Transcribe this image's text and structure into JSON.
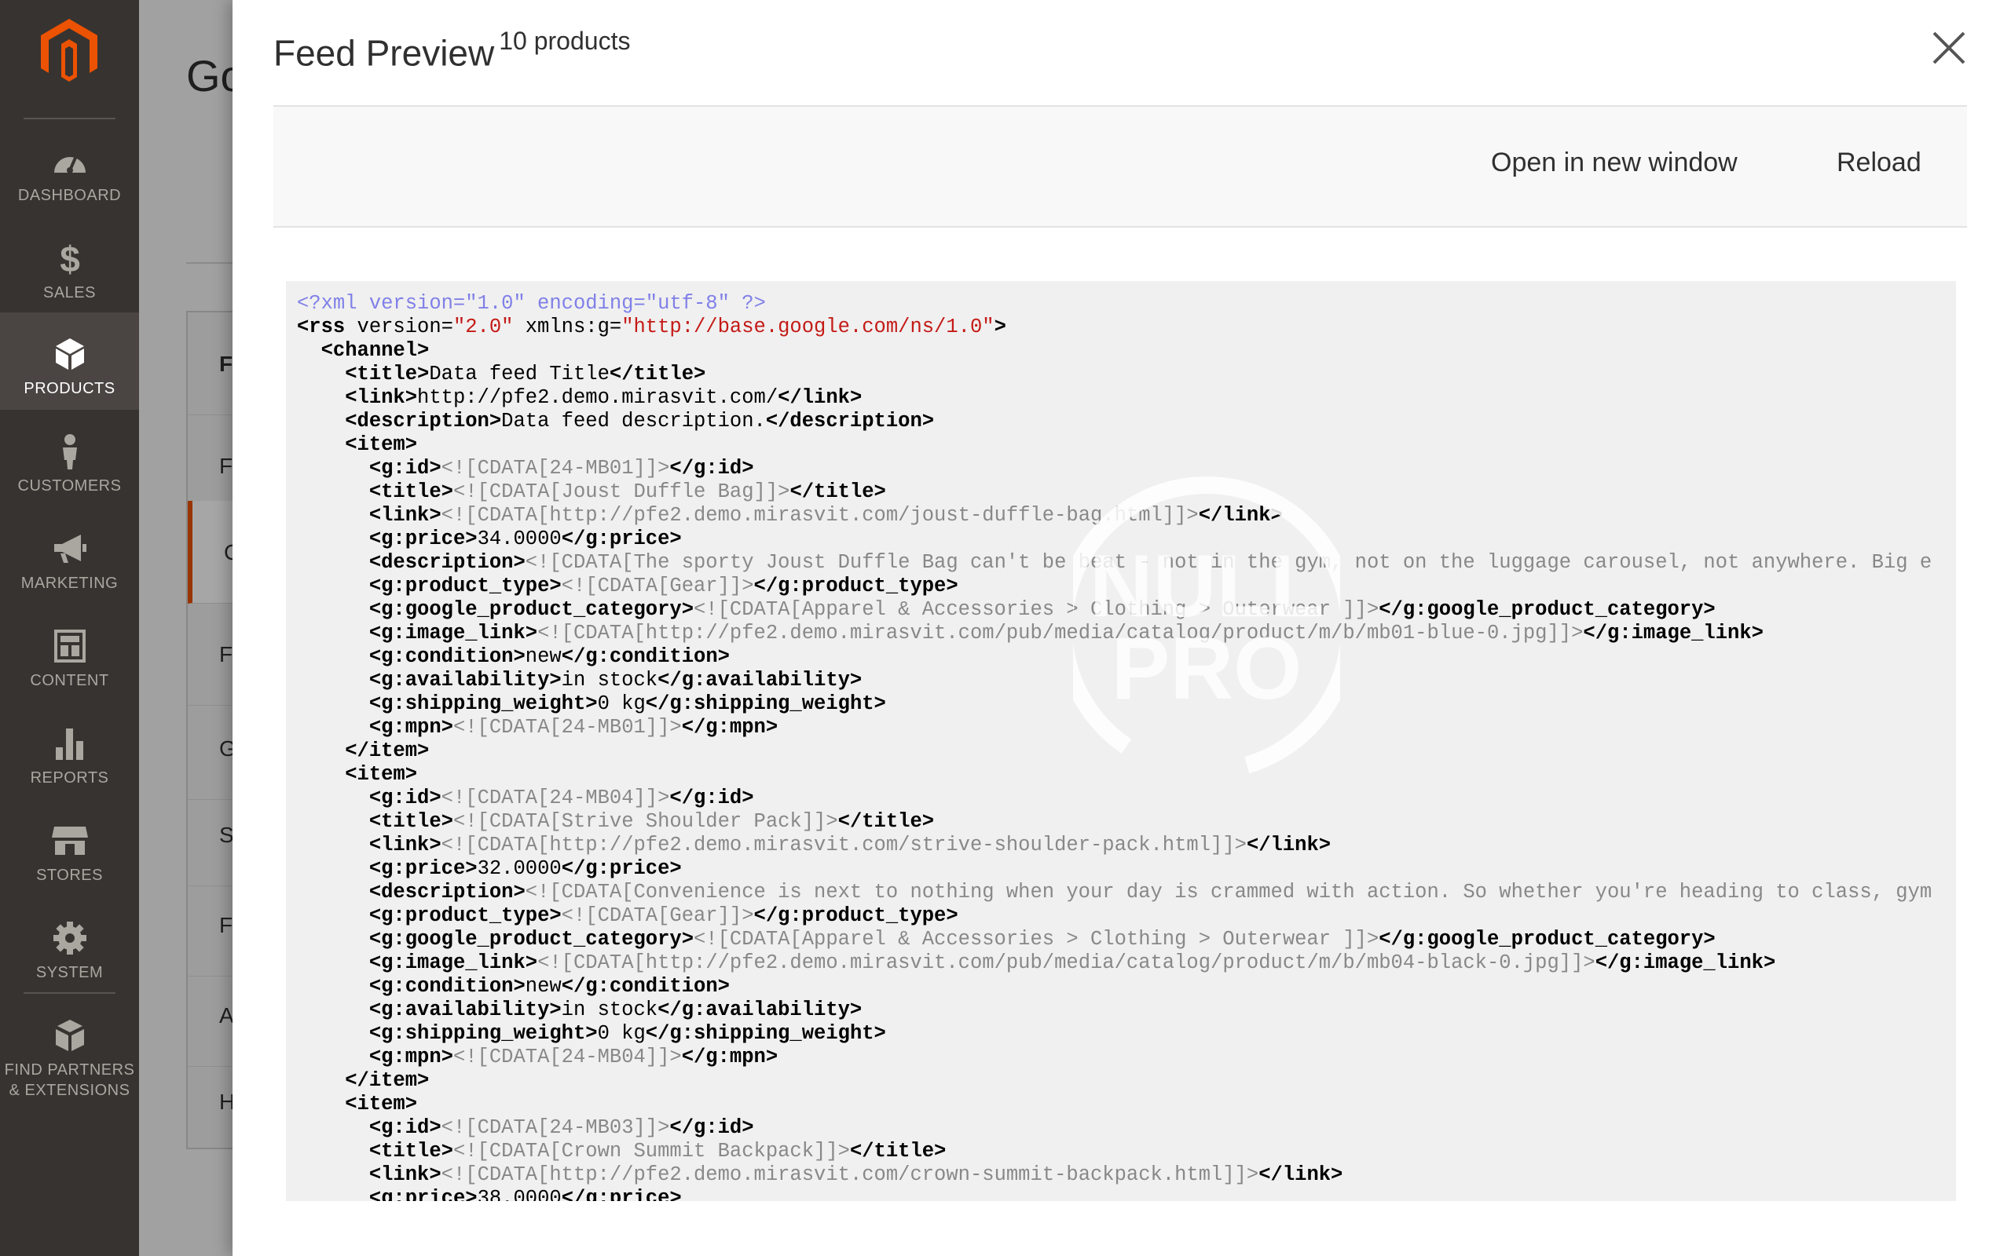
{
  "sidebar": {
    "items": [
      {
        "label": "DASHBOARD",
        "icon": "dashboard-icon"
      },
      {
        "label": "SALES",
        "icon": "dollar-icon"
      },
      {
        "label": "PRODUCTS",
        "icon": "cube-icon",
        "active": true
      },
      {
        "label": "CUSTOMERS",
        "icon": "person-icon"
      },
      {
        "label": "MARKETING",
        "icon": "megaphone-icon"
      },
      {
        "label": "CONTENT",
        "icon": "layout-icon"
      },
      {
        "label": "REPORTS",
        "icon": "bar-chart-icon"
      },
      {
        "label": "STORES",
        "icon": "storefront-icon"
      },
      {
        "label": "SYSTEM",
        "icon": "gear-icon"
      },
      {
        "label": "FIND PARTNERS & EXTENSIONS",
        "icon": "boxes-icon"
      }
    ]
  },
  "background": {
    "title": "Go",
    "panel_head": "FE",
    "tabs": [
      "F",
      "C",
      "Fi",
      "G",
      "S",
      "Fi",
      "A",
      "H"
    ]
  },
  "modal": {
    "title": "Feed Preview",
    "subtitle": "10 products",
    "toolbar": {
      "open_label": "Open in new window",
      "reload_label": "Reload"
    }
  },
  "watermark": {
    "top": "NULL",
    "bottom": "PRO"
  },
  "xml_lines": [
    {
      "i": 0,
      "p": [
        [
          "pi",
          "<?xml version=\"1.0\" encoding=\"utf-8\" ?>"
        ]
      ]
    },
    {
      "i": 0,
      "p": [
        [
          "t",
          "<rss "
        ],
        [
          "an",
          "version="
        ],
        [
          "av",
          "\"2.0\""
        ],
        [
          "an",
          " xmlns:g="
        ],
        [
          "av",
          "\"http://base.google.com/ns/1.0\""
        ],
        [
          "t",
          ">"
        ]
      ]
    },
    {
      "i": 1,
      "p": [
        [
          "t",
          "<channel>"
        ]
      ]
    },
    {
      "i": 2,
      "p": [
        [
          "t",
          "<title>"
        ],
        [
          "tx",
          "Data feed Title"
        ],
        [
          "t",
          "</title>"
        ]
      ]
    },
    {
      "i": 2,
      "p": [
        [
          "t",
          "<link>"
        ],
        [
          "tx",
          "http://pfe2.demo.mirasvit.com/"
        ],
        [
          "t",
          "</link>"
        ]
      ]
    },
    {
      "i": 2,
      "p": [
        [
          "t",
          "<description>"
        ],
        [
          "tx",
          "Data feed description."
        ],
        [
          "t",
          "</description>"
        ]
      ]
    },
    {
      "i": 2,
      "p": [
        [
          "t",
          "<item>"
        ]
      ]
    },
    {
      "i": 3,
      "p": [
        [
          "t",
          "<g:id>"
        ],
        [
          "cd",
          "<![CDATA[24-MB01]]>"
        ],
        [
          "t",
          "</g:id>"
        ]
      ]
    },
    {
      "i": 3,
      "p": [
        [
          "t",
          "<title>"
        ],
        [
          "cd",
          "<![CDATA[Joust Duffle Bag]]>"
        ],
        [
          "t",
          "</title>"
        ]
      ]
    },
    {
      "i": 3,
      "p": [
        [
          "t",
          "<link>"
        ],
        [
          "cd",
          "<![CDATA[http://pfe2.demo.mirasvit.com/joust-duffle-bag.html]]>"
        ],
        [
          "t",
          "</link>"
        ]
      ]
    },
    {
      "i": 3,
      "p": [
        [
          "t",
          "<g:price>"
        ],
        [
          "tx",
          "34.0000"
        ],
        [
          "t",
          "</g:price>"
        ]
      ]
    },
    {
      "i": 3,
      "p": [
        [
          "t",
          "<description>"
        ],
        [
          "cd",
          "<![CDATA[The sporty Joust Duffle Bag can't be beat - not in the gym, not on the luggage carousel, not anywhere. Big e"
        ]
      ]
    },
    {
      "i": 3,
      "p": [
        [
          "t",
          "<g:product_type>"
        ],
        [
          "cd",
          "<![CDATA[Gear]]>"
        ],
        [
          "t",
          "</g:product_type>"
        ]
      ]
    },
    {
      "i": 3,
      "p": [
        [
          "t",
          "<g:google_product_category>"
        ],
        [
          "cd",
          "<![CDATA[Apparel & Accessories > Clothing > Outerwear ]]>"
        ],
        [
          "t",
          "</g:google_product_category>"
        ]
      ]
    },
    {
      "i": 3,
      "p": [
        [
          "t",
          "<g:image_link>"
        ],
        [
          "cd",
          "<![CDATA[http://pfe2.demo.mirasvit.com/pub/media/catalog/product/m/b/mb01-blue-0.jpg]]>"
        ],
        [
          "t",
          "</g:image_link>"
        ]
      ]
    },
    {
      "i": 3,
      "p": [
        [
          "t",
          "<g:condition>"
        ],
        [
          "tx",
          "new"
        ],
        [
          "t",
          "</g:condition>"
        ]
      ]
    },
    {
      "i": 3,
      "p": [
        [
          "t",
          "<g:availability>"
        ],
        [
          "tx",
          "in stock"
        ],
        [
          "t",
          "</g:availability>"
        ]
      ]
    },
    {
      "i": 3,
      "p": [
        [
          "t",
          "<g:shipping_weight>"
        ],
        [
          "tx",
          "0 kg"
        ],
        [
          "t",
          "</g:shipping_weight>"
        ]
      ]
    },
    {
      "i": 3,
      "p": [
        [
          "t",
          "<g:mpn>"
        ],
        [
          "cd",
          "<![CDATA[24-MB01]]>"
        ],
        [
          "t",
          "</g:mpn>"
        ]
      ]
    },
    {
      "i": 2,
      "p": [
        [
          "t",
          "</item>"
        ]
      ]
    },
    {
      "i": 2,
      "p": [
        [
          "t",
          "<item>"
        ]
      ]
    },
    {
      "i": 3,
      "p": [
        [
          "t",
          "<g:id>"
        ],
        [
          "cd",
          "<![CDATA[24-MB04]]>"
        ],
        [
          "t",
          "</g:id>"
        ]
      ]
    },
    {
      "i": 3,
      "p": [
        [
          "t",
          "<title>"
        ],
        [
          "cd",
          "<![CDATA[Strive Shoulder Pack]]>"
        ],
        [
          "t",
          "</title>"
        ]
      ]
    },
    {
      "i": 3,
      "p": [
        [
          "t",
          "<link>"
        ],
        [
          "cd",
          "<![CDATA[http://pfe2.demo.mirasvit.com/strive-shoulder-pack.html]]>"
        ],
        [
          "t",
          "</link>"
        ]
      ]
    },
    {
      "i": 3,
      "p": [
        [
          "t",
          "<g:price>"
        ],
        [
          "tx",
          "32.0000"
        ],
        [
          "t",
          "</g:price>"
        ]
      ]
    },
    {
      "i": 3,
      "p": [
        [
          "t",
          "<description>"
        ],
        [
          "cd",
          "<![CDATA[Convenience is next to nothing when your day is crammed with action. So whether you're heading to class, gym"
        ]
      ]
    },
    {
      "i": 3,
      "p": [
        [
          "t",
          "<g:product_type>"
        ],
        [
          "cd",
          "<![CDATA[Gear]]>"
        ],
        [
          "t",
          "</g:product_type>"
        ]
      ]
    },
    {
      "i": 3,
      "p": [
        [
          "t",
          "<g:google_product_category>"
        ],
        [
          "cd",
          "<![CDATA[Apparel & Accessories > Clothing > Outerwear ]]>"
        ],
        [
          "t",
          "</g:google_product_category>"
        ]
      ]
    },
    {
      "i": 3,
      "p": [
        [
          "t",
          "<g:image_link>"
        ],
        [
          "cd",
          "<![CDATA[http://pfe2.demo.mirasvit.com/pub/media/catalog/product/m/b/mb04-black-0.jpg]]>"
        ],
        [
          "t",
          "</g:image_link>"
        ]
      ]
    },
    {
      "i": 3,
      "p": [
        [
          "t",
          "<g:condition>"
        ],
        [
          "tx",
          "new"
        ],
        [
          "t",
          "</g:condition>"
        ]
      ]
    },
    {
      "i": 3,
      "p": [
        [
          "t",
          "<g:availability>"
        ],
        [
          "tx",
          "in stock"
        ],
        [
          "t",
          "</g:availability>"
        ]
      ]
    },
    {
      "i": 3,
      "p": [
        [
          "t",
          "<g:shipping_weight>"
        ],
        [
          "tx",
          "0 kg"
        ],
        [
          "t",
          "</g:shipping_weight>"
        ]
      ]
    },
    {
      "i": 3,
      "p": [
        [
          "t",
          "<g:mpn>"
        ],
        [
          "cd",
          "<![CDATA[24-MB04]]>"
        ],
        [
          "t",
          "</g:mpn>"
        ]
      ]
    },
    {
      "i": 2,
      "p": [
        [
          "t",
          "</item>"
        ]
      ]
    },
    {
      "i": 2,
      "p": [
        [
          "t",
          "<item>"
        ]
      ]
    },
    {
      "i": 3,
      "p": [
        [
          "t",
          "<g:id>"
        ],
        [
          "cd",
          "<![CDATA[24-MB03]]>"
        ],
        [
          "t",
          "</g:id>"
        ]
      ]
    },
    {
      "i": 3,
      "p": [
        [
          "t",
          "<title>"
        ],
        [
          "cd",
          "<![CDATA[Crown Summit Backpack]]>"
        ],
        [
          "t",
          "</title>"
        ]
      ]
    },
    {
      "i": 3,
      "p": [
        [
          "t",
          "<link>"
        ],
        [
          "cd",
          "<![CDATA[http://pfe2.demo.mirasvit.com/crown-summit-backpack.html]]>"
        ],
        [
          "t",
          "</link>"
        ]
      ]
    },
    {
      "i": 3,
      "p": [
        [
          "t",
          "<g:price>"
        ],
        [
          "tx",
          "38.0000"
        ],
        [
          "t",
          "</g:price>"
        ]
      ]
    }
  ],
  "colors": {
    "sidebar_bg": "#373330",
    "sidebar_active": "#4a4542",
    "accent": "#eb5202",
    "xml_decl": "#8080e8",
    "attr_value": "#c41a16",
    "cdata": "#888888"
  }
}
